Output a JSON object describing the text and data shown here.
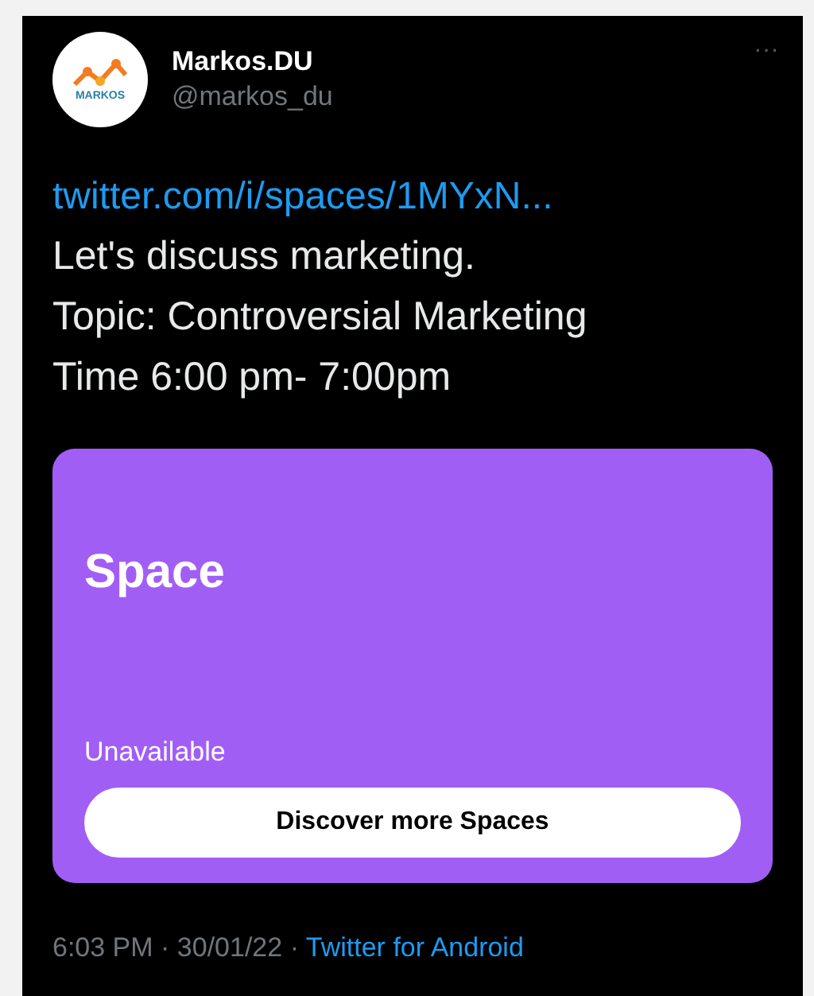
{
  "tweet": {
    "avatar_text": "MARKOS",
    "name": "Markos.DU",
    "handle": "@markos_du",
    "more": "···",
    "link": "twitter.com/i/spaces/1MYxN...",
    "lines": [
      "Let's discuss marketing.",
      "Topic: Controversial Marketing",
      "Time 6:00 pm- 7:00pm"
    ],
    "space_card": {
      "title": "Space",
      "status": "Unavailable",
      "button": "Discover more Spaces"
    },
    "timestamp": "6:03 PM · 30/01/22 · ",
    "source": "Twitter for Android"
  }
}
